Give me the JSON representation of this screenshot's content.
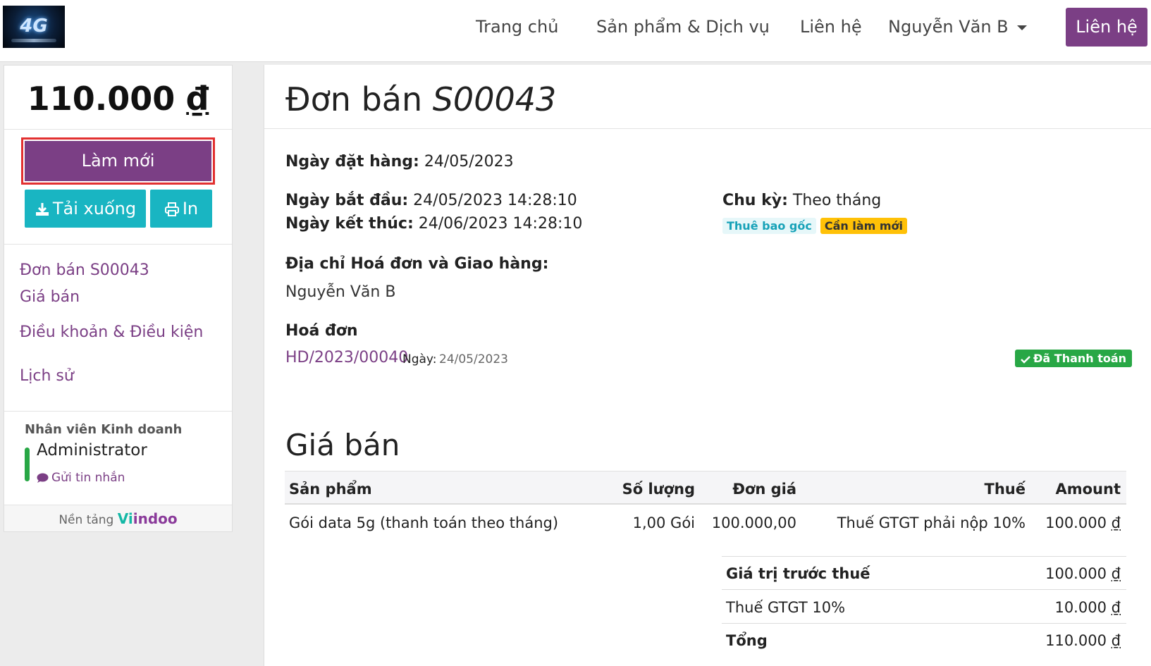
{
  "nav": {
    "logo_text": "4G",
    "items": [
      "Trang chủ",
      "Sản phẩm & Dịch vụ",
      "Liên hệ"
    ],
    "user": "Nguyễn Văn B",
    "cta": "Liên hệ"
  },
  "sidebar": {
    "total_amount": "110.000",
    "currency": "₫",
    "renew_label": "Làm mới",
    "download_label": "Tải xuống",
    "print_label": "In",
    "links": [
      "Đơn bán S00043",
      "Giá bán",
      "Điều khoản & Điều kiện",
      "Lịch sử"
    ],
    "salesperson_label": "Nhân viên Kinh doanh",
    "salesperson_name": "Administrator",
    "send_message": "Gửi tin nhắn",
    "powered_by": "Nền tảng",
    "brand_v": "Vi",
    "brand_rest": "indoo"
  },
  "order": {
    "title_prefix": "Đơn bán",
    "number": "S00043",
    "order_date_label": "Ngày đặt hàng:",
    "order_date": "24/05/2023",
    "start_label": "Ngày bắt đầu:",
    "start": "24/05/2023 14:28:10",
    "end_label": "Ngày kết thúc:",
    "end": "24/06/2023 14:28:10",
    "cycle_label": "Chu kỳ:",
    "cycle": "Theo tháng",
    "badge_root": "Thuê bao gốc",
    "badge_renew": "Cần làm mới",
    "address_label": "Địa chỉ Hoá đơn và Giao hàng:",
    "address_name": "Nguyễn Văn B",
    "invoice_heading": "Hoá đơn",
    "invoice_number": "HD/2023/00040",
    "invoice_date_label": "Ngày:",
    "invoice_date": "24/05/2023",
    "paid_label": "Đã Thanh toán",
    "colors": {
      "primary": "#7b3f85",
      "info": "#19b5c2",
      "success": "#28a745",
      "warning": "#ffc107"
    }
  },
  "pricing": {
    "heading": "Giá bán",
    "columns": [
      "Sản phẩm",
      "Số lượng",
      "Đơn giá",
      "Thuế",
      "Amount"
    ],
    "rows": [
      {
        "product": "Gói data 5g (thanh toán theo tháng)",
        "qty": "1,00 Gói",
        "price": "100.000,00",
        "tax": "Thuế GTGT phải nộp 10%",
        "amount": "100.000"
      }
    ],
    "subtotal_label": "Giá trị trước thuế",
    "subtotal": "100.000",
    "tax_label": "Thuế GTGT 10%",
    "tax": "10.000",
    "total_label": "Tổng",
    "total": "110.000",
    "currency": "₫"
  }
}
